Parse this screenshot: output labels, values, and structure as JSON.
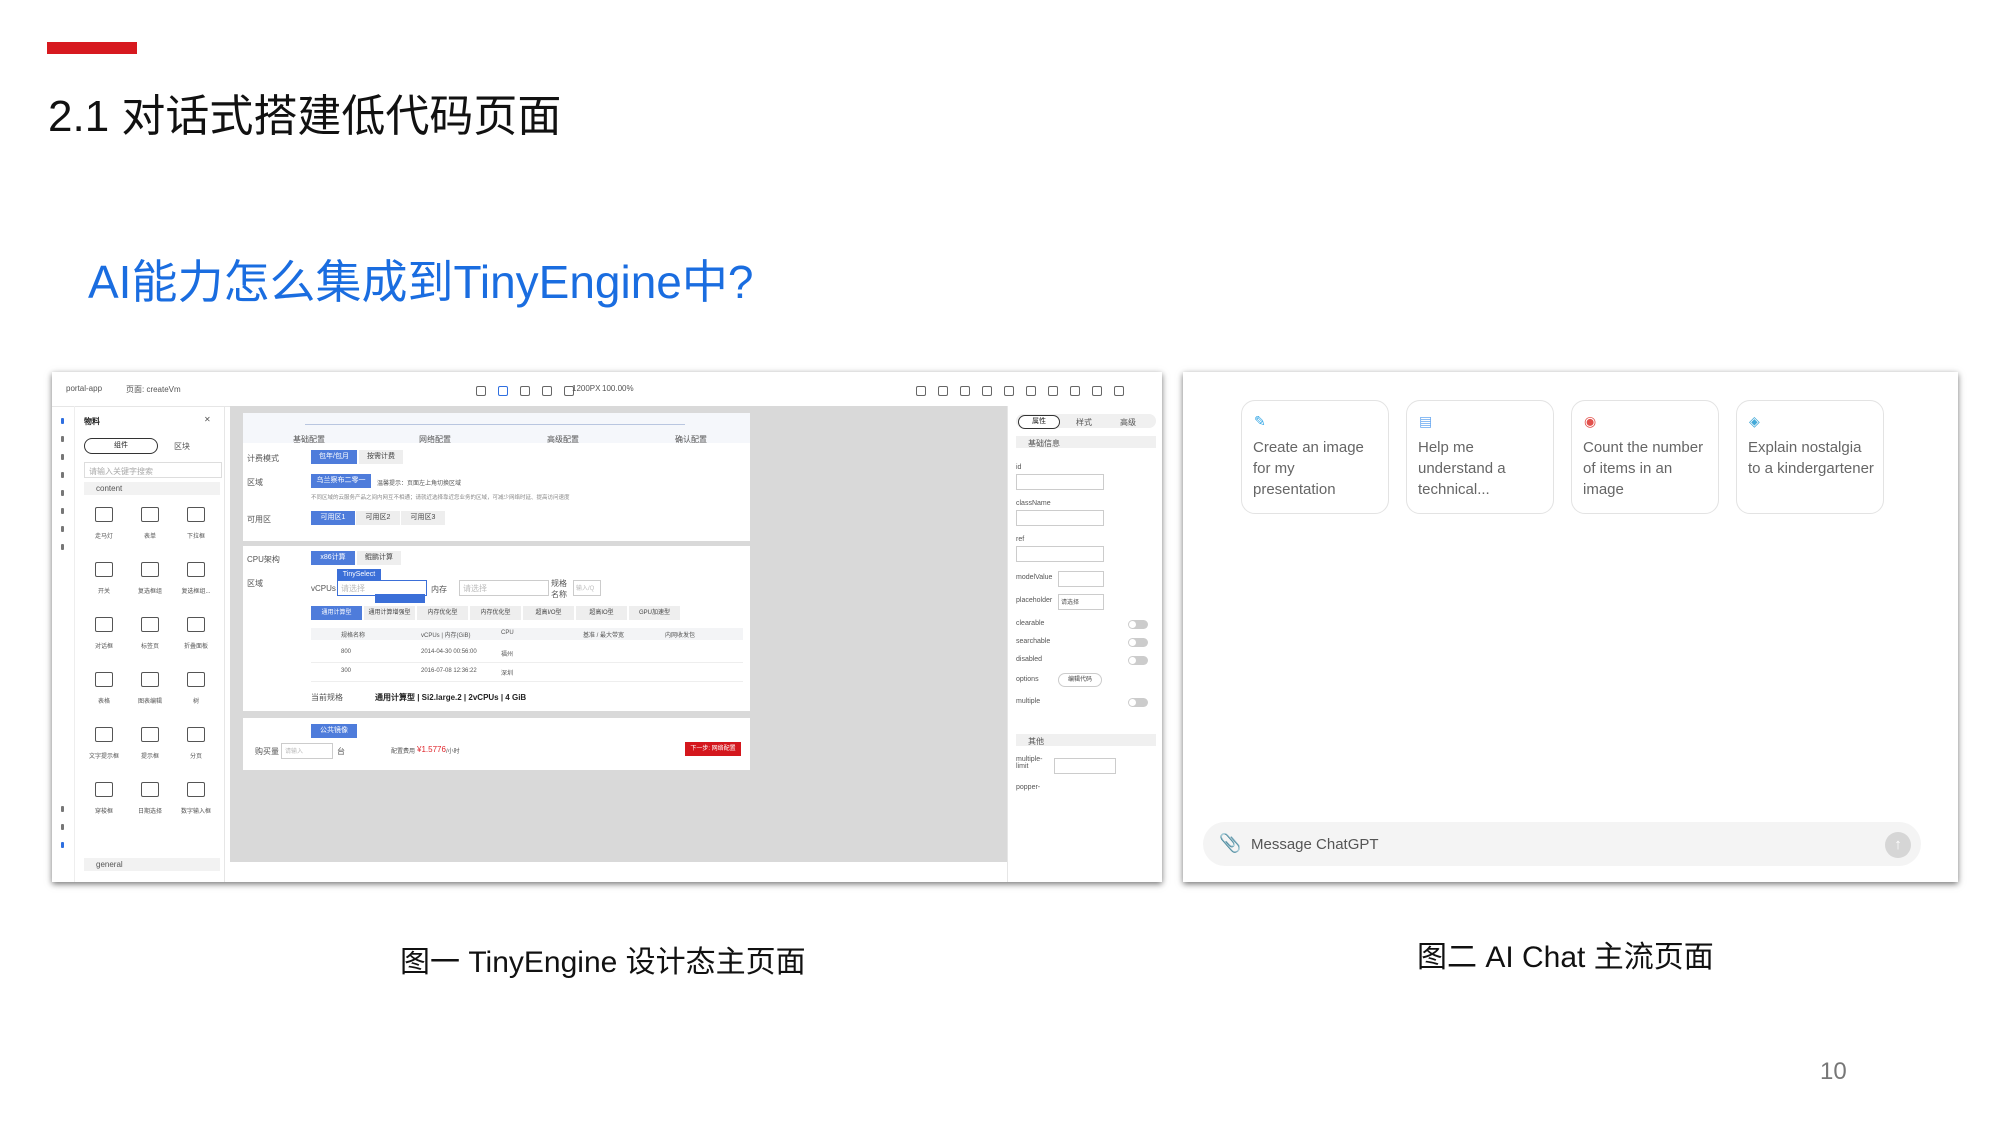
{
  "slide": {
    "title": "2.1 对话式搭建低代码页面",
    "subtitle": "AI能力怎么集成到TinyEngine中?",
    "caption_left": "图一  TinyEngine 设计态主页面",
    "caption_right": "图二  AI Chat 主流页面",
    "page_number": "10",
    "accent_color": "#d7191f",
    "subtitle_color": "#1a6de0"
  },
  "tinyengine": {
    "app": "portal-app",
    "page": "页面: createVm",
    "viewport": "1200PX",
    "zoom": "100.00%",
    "panel_title": "物料",
    "tabs": [
      "组件",
      "区块"
    ],
    "search_placeholder": "请输入关键字搜索",
    "group_content": "content",
    "group_general": "general",
    "components": [
      "走马灯",
      "表单",
      "下拉框",
      "开关",
      "复选框组",
      "复选框组...",
      "对话框",
      "标签页",
      "折叠面板",
      "表格",
      "图表编辑",
      "树",
      "文字提示框",
      "提示框",
      "分页",
      "穿梭框",
      "日期选择",
      "数字输入框"
    ],
    "steps": [
      "基础配置",
      "网络配置",
      "高级配置",
      "确认配置"
    ],
    "form": {
      "billing_label": "计费模式",
      "billing_options": [
        "包年/包月",
        "按需计费"
      ],
      "region_label": "区域",
      "region_value": "乌兰察布二零一",
      "region_hint": "温馨提示：页面左上角切换区域",
      "region_note": "不同区域的云服务产品之间内网互不相通；请就近选择靠近您业务的区域，可减少网络时延、提高访问速度",
      "zone_label": "可用区",
      "zones": [
        "可用区1",
        "可用区2",
        "可用区3"
      ],
      "cpu_label": "CPU架构",
      "cpu_options": [
        "x86计算",
        "鲲鹏计算"
      ],
      "region2_label": "区域",
      "vcpu_label": "vCPUs",
      "vcpu_placeholder": "请选择",
      "mem_label": "内存",
      "mem_placeholder": "请选择",
      "spec_label": "规格名称",
      "spec_placeholder": "输入/Q",
      "selected_component": "TinySelect",
      "instance_tabs": [
        "通用计算型",
        "通用计算增强型",
        "内存优化型",
        "内存优化型",
        "超高I/O型",
        "超高IO型",
        "GPU加速型"
      ],
      "table_headers": [
        "规格名称",
        "vCPUs | 内存(GiB)",
        "CPU",
        "基准 / 最大带宽",
        "内网收发包"
      ],
      "rows": [
        [
          "800",
          "2014-04-30 00:56:00",
          "福州"
        ],
        [
          "300",
          "2016-07-08 12:36:22",
          "深圳"
        ]
      ],
      "current_spec_label": "当前规格",
      "current_spec": "通用计算型 | Si2.large.2 | 2vCPUs | 4 GiB",
      "image_btn": "公共镜像",
      "buy_label": "购买量",
      "buy_placeholder": "请输入",
      "buy_unit": "台",
      "fee_label": "配置费用",
      "fee": "¥1.5776",
      "fee_unit": "/小时",
      "next_btn": "下一步: 网络配置"
    },
    "right_panel": {
      "tabs": [
        "属性",
        "样式",
        "高级"
      ],
      "section_basic": "基础信息",
      "fields": [
        "id",
        "className",
        "ref",
        "modelValue",
        "placeholder",
        "clearable",
        "searchable",
        "disabled",
        "options",
        "multiple"
      ],
      "placeholder_value": "请选择",
      "options_button": "编辑代码",
      "section_other": "其他",
      "other_fields": [
        "multiple-limit",
        "popper-"
      ]
    }
  },
  "chat": {
    "suggestions": [
      {
        "icon": "image-edit-icon",
        "color": "#35a7e6",
        "text": "Create an image for my presentation"
      },
      {
        "icon": "document-icon",
        "color": "#6aa9f0",
        "text": "Help me understand a technical..."
      },
      {
        "icon": "eye-icon",
        "color": "#e2514c",
        "text": "Count the number of items in an image"
      },
      {
        "icon": "graduation-cap-icon",
        "color": "#43a9d8",
        "text": "Explain nostalgia to a kindergartener"
      }
    ],
    "input_placeholder": "Message ChatGPT"
  }
}
